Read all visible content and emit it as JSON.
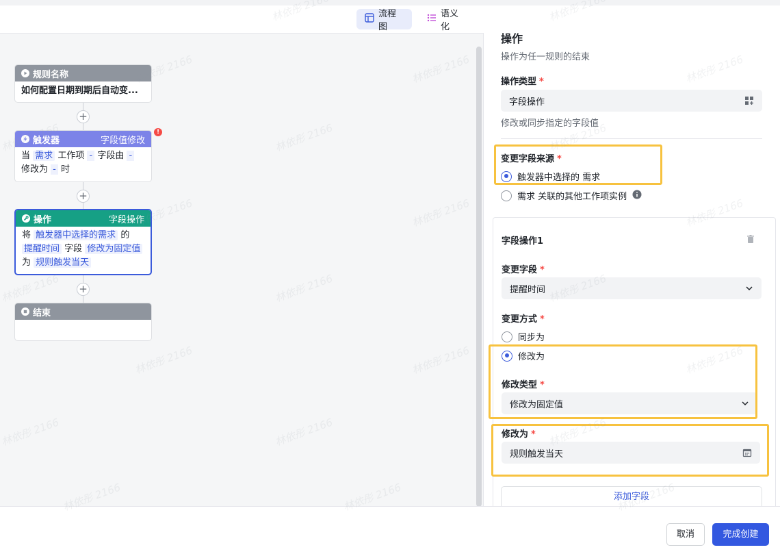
{
  "view_tabs": {
    "flowchart": "流程图",
    "semantic": "语义化"
  },
  "flow": {
    "rule_name_node": {
      "title": "规则名称",
      "body": "如何配置日期到期后自动变..."
    },
    "trigger_node": {
      "title": "触发器",
      "tag": "字段值修改",
      "alert": "!",
      "when": "当",
      "item_type": "需求",
      "work_item": "工作项",
      "dash1": "-",
      "field_from": "字段由",
      "dash2": "-",
      "changed_to": "修改为",
      "dash3": "-",
      "time_suffix": "时"
    },
    "action_node": {
      "title": "操作",
      "tag": "字段操作",
      "will": "将",
      "source": "触发器中选择的需求",
      "of": "的",
      "field": "提醒时间",
      "field_word": "字段",
      "modify_type": "修改为固定值",
      "as_word": "为",
      "value": "规则触发当天"
    },
    "end_node": {
      "title": "结束"
    },
    "plus": "+"
  },
  "panel": {
    "title": "操作",
    "subtitle": "操作为任一规则的结束",
    "operation_type": {
      "label": "操作类型",
      "required": "*",
      "value": "字段操作",
      "hint": "修改或同步指定的字段值"
    },
    "source": {
      "label": "变更字段来源",
      "required": "*",
      "option1": "触发器中选择的 需求",
      "option2": "需求 关联的其他工作项实例",
      "selected": "option1"
    },
    "field_op": {
      "title": "字段操作1",
      "change_field_label": "变更字段",
      "required": "*",
      "change_field_value": "提醒时间",
      "change_method_label": "变更方式",
      "method_sync": "同步为",
      "method_modify": "修改为",
      "selected_method": "修改为",
      "modify_type_label": "修改类型",
      "modify_type_value": "修改为固定值",
      "modify_to_label": "修改为",
      "modify_to_value": "规则触发当天"
    },
    "add_field": "添加字段"
  },
  "footer": {
    "cancel": "取消",
    "confirm": "完成创建"
  },
  "watermark": "林依彤 2166",
  "colors": {
    "primary": "#3358e0",
    "trigger_header": "#7c83e8",
    "action_header": "#16a085",
    "neutral_header": "#8f959e",
    "highlight": "#f7c23f",
    "required": "#f54a45"
  }
}
